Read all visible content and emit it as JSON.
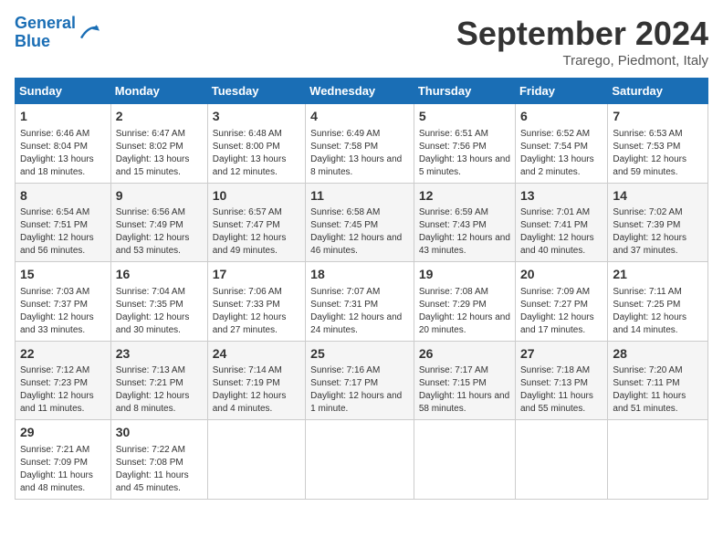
{
  "header": {
    "logo_line1": "General",
    "logo_line2": "Blue",
    "month": "September 2024",
    "location": "Trarego, Piedmont, Italy"
  },
  "days_of_week": [
    "Sunday",
    "Monday",
    "Tuesday",
    "Wednesday",
    "Thursday",
    "Friday",
    "Saturday"
  ],
  "weeks": [
    [
      {
        "day": "1",
        "info": "Sunrise: 6:46 AM\nSunset: 8:04 PM\nDaylight: 13 hours and 18 minutes."
      },
      {
        "day": "2",
        "info": "Sunrise: 6:47 AM\nSunset: 8:02 PM\nDaylight: 13 hours and 15 minutes."
      },
      {
        "day": "3",
        "info": "Sunrise: 6:48 AM\nSunset: 8:00 PM\nDaylight: 13 hours and 12 minutes."
      },
      {
        "day": "4",
        "info": "Sunrise: 6:49 AM\nSunset: 7:58 PM\nDaylight: 13 hours and 8 minutes."
      },
      {
        "day": "5",
        "info": "Sunrise: 6:51 AM\nSunset: 7:56 PM\nDaylight: 13 hours and 5 minutes."
      },
      {
        "day": "6",
        "info": "Sunrise: 6:52 AM\nSunset: 7:54 PM\nDaylight: 13 hours and 2 minutes."
      },
      {
        "day": "7",
        "info": "Sunrise: 6:53 AM\nSunset: 7:53 PM\nDaylight: 12 hours and 59 minutes."
      }
    ],
    [
      {
        "day": "8",
        "info": "Sunrise: 6:54 AM\nSunset: 7:51 PM\nDaylight: 12 hours and 56 minutes."
      },
      {
        "day": "9",
        "info": "Sunrise: 6:56 AM\nSunset: 7:49 PM\nDaylight: 12 hours and 53 minutes."
      },
      {
        "day": "10",
        "info": "Sunrise: 6:57 AM\nSunset: 7:47 PM\nDaylight: 12 hours and 49 minutes."
      },
      {
        "day": "11",
        "info": "Sunrise: 6:58 AM\nSunset: 7:45 PM\nDaylight: 12 hours and 46 minutes."
      },
      {
        "day": "12",
        "info": "Sunrise: 6:59 AM\nSunset: 7:43 PM\nDaylight: 12 hours and 43 minutes."
      },
      {
        "day": "13",
        "info": "Sunrise: 7:01 AM\nSunset: 7:41 PM\nDaylight: 12 hours and 40 minutes."
      },
      {
        "day": "14",
        "info": "Sunrise: 7:02 AM\nSunset: 7:39 PM\nDaylight: 12 hours and 37 minutes."
      }
    ],
    [
      {
        "day": "15",
        "info": "Sunrise: 7:03 AM\nSunset: 7:37 PM\nDaylight: 12 hours and 33 minutes."
      },
      {
        "day": "16",
        "info": "Sunrise: 7:04 AM\nSunset: 7:35 PM\nDaylight: 12 hours and 30 minutes."
      },
      {
        "day": "17",
        "info": "Sunrise: 7:06 AM\nSunset: 7:33 PM\nDaylight: 12 hours and 27 minutes."
      },
      {
        "day": "18",
        "info": "Sunrise: 7:07 AM\nSunset: 7:31 PM\nDaylight: 12 hours and 24 minutes."
      },
      {
        "day": "19",
        "info": "Sunrise: 7:08 AM\nSunset: 7:29 PM\nDaylight: 12 hours and 20 minutes."
      },
      {
        "day": "20",
        "info": "Sunrise: 7:09 AM\nSunset: 7:27 PM\nDaylight: 12 hours and 17 minutes."
      },
      {
        "day": "21",
        "info": "Sunrise: 7:11 AM\nSunset: 7:25 PM\nDaylight: 12 hours and 14 minutes."
      }
    ],
    [
      {
        "day": "22",
        "info": "Sunrise: 7:12 AM\nSunset: 7:23 PM\nDaylight: 12 hours and 11 minutes."
      },
      {
        "day": "23",
        "info": "Sunrise: 7:13 AM\nSunset: 7:21 PM\nDaylight: 12 hours and 8 minutes."
      },
      {
        "day": "24",
        "info": "Sunrise: 7:14 AM\nSunset: 7:19 PM\nDaylight: 12 hours and 4 minutes."
      },
      {
        "day": "25",
        "info": "Sunrise: 7:16 AM\nSunset: 7:17 PM\nDaylight: 12 hours and 1 minute."
      },
      {
        "day": "26",
        "info": "Sunrise: 7:17 AM\nSunset: 7:15 PM\nDaylight: 11 hours and 58 minutes."
      },
      {
        "day": "27",
        "info": "Sunrise: 7:18 AM\nSunset: 7:13 PM\nDaylight: 11 hours and 55 minutes."
      },
      {
        "day": "28",
        "info": "Sunrise: 7:20 AM\nSunset: 7:11 PM\nDaylight: 11 hours and 51 minutes."
      }
    ],
    [
      {
        "day": "29",
        "info": "Sunrise: 7:21 AM\nSunset: 7:09 PM\nDaylight: 11 hours and 48 minutes."
      },
      {
        "day": "30",
        "info": "Sunrise: 7:22 AM\nSunset: 7:08 PM\nDaylight: 11 hours and 45 minutes."
      },
      null,
      null,
      null,
      null,
      null
    ]
  ]
}
